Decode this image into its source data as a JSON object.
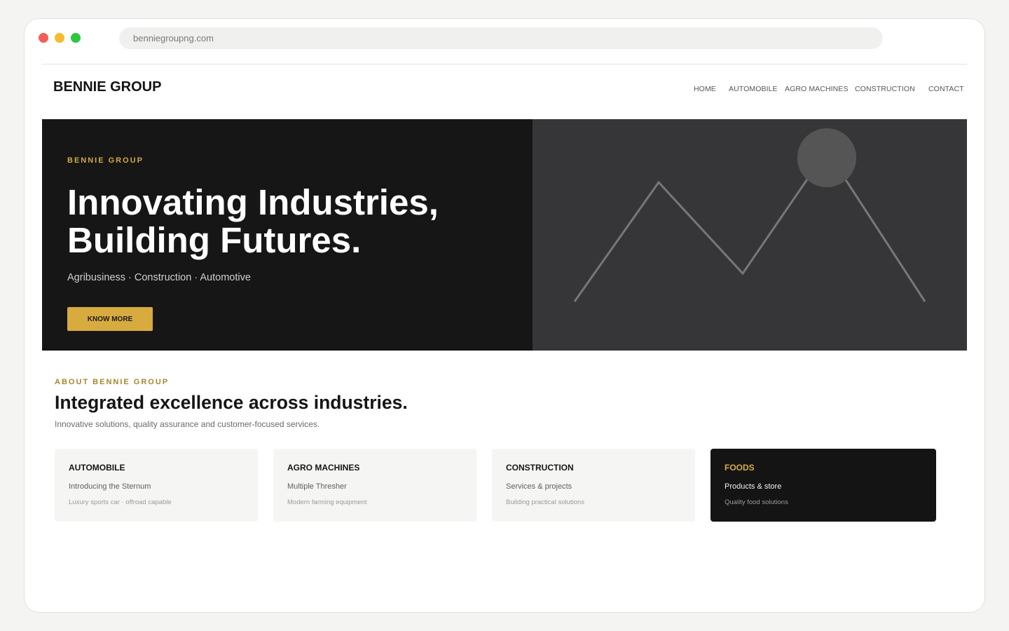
{
  "browser": {
    "url": "benniegroupng.com"
  },
  "site": {
    "logo": "BENNIE GROUP",
    "nav": [
      {
        "label": "HOME"
      },
      {
        "label": "AUTOMOBILE"
      },
      {
        "label": "AGRO MACHINES"
      },
      {
        "label": "CONSTRUCTION"
      },
      {
        "label": "CONTACT"
      }
    ]
  },
  "hero": {
    "eyebrow": "BENNIE GROUP",
    "title_line1": "Innovating Industries,",
    "title_line2": "Building Futures.",
    "subtitle": "Agribusiness · Construction · Automotive",
    "button_label": "KNOW MORE",
    "image_icon": "mountain-image-placeholder-icon"
  },
  "about": {
    "eyebrow": "ABOUT BENNIE GROUP",
    "title": "Integrated excellence across industries.",
    "subtitle": "Innovative solutions, quality assurance and customer-focused services."
  },
  "cards": [
    {
      "title": "AUTOMOBILE",
      "line1": "Introducing the Sternum",
      "line2": "Luxury sports car · offroad capable",
      "dark": false
    },
    {
      "title": "AGRO MACHINES",
      "line1": "Multiple Thresher",
      "line2": "Modern farming equipment",
      "dark": false
    },
    {
      "title": "CONSTRUCTION",
      "line1": "Services & projects",
      "line2": "Building practical solutions",
      "dark": false
    },
    {
      "title": "FOODS",
      "line1": "Products & store",
      "line2": "Quality food solutions",
      "dark": true
    }
  ],
  "colors": {
    "accent": "#d8ab3f",
    "hero_bg": "#161616",
    "hero_image_bg": "#363638",
    "window_controls": [
      "#f25f57",
      "#f5bb2e",
      "#2bc840"
    ]
  }
}
